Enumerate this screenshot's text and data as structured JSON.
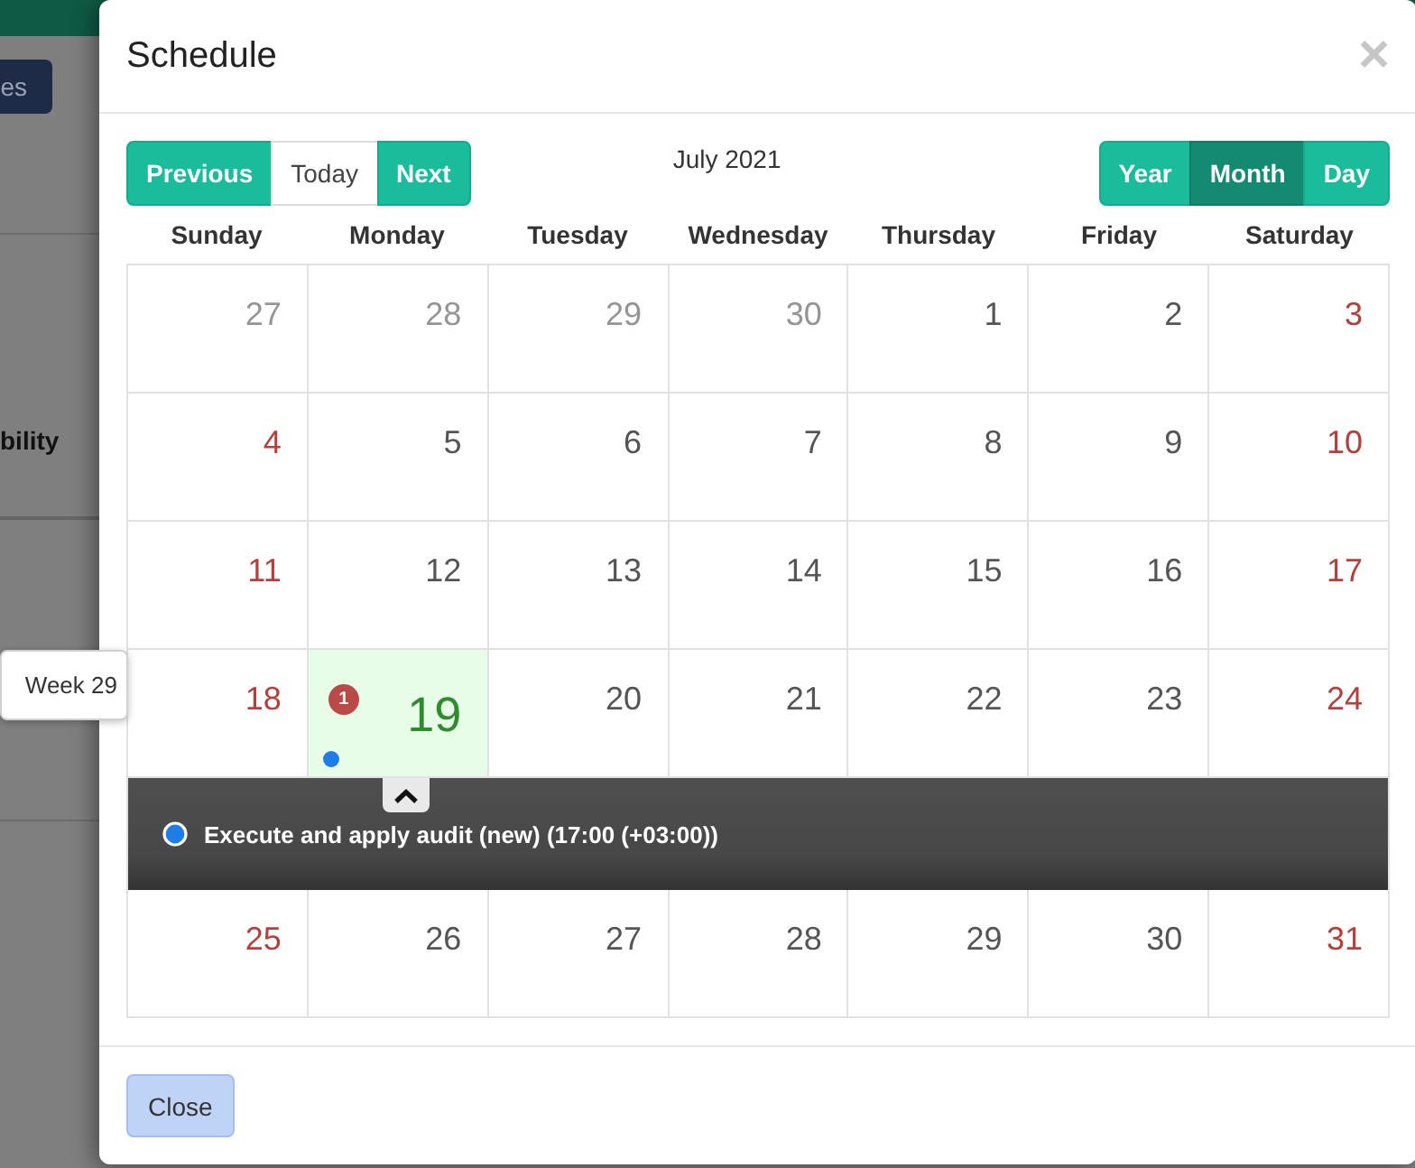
{
  "background": {
    "button": "es",
    "label": "bility"
  },
  "dialog": {
    "title": "Schedule",
    "close_symbol": "×"
  },
  "toolbar": {
    "nav": [
      {
        "label": "Previous",
        "kind": "primary"
      },
      {
        "label": "Today",
        "kind": "default"
      },
      {
        "label": "Next",
        "kind": "primary"
      }
    ],
    "period": "July 2021",
    "views": [
      {
        "label": "Year",
        "selected": false
      },
      {
        "label": "Month",
        "selected": true
      },
      {
        "label": "Day",
        "selected": false
      }
    ]
  },
  "weekdays": [
    {
      "label": "Sunday",
      "weekend": true
    },
    {
      "label": "Monday",
      "weekend": false
    },
    {
      "label": "Tuesday",
      "weekend": false
    },
    {
      "label": "Wednesday",
      "weekend": false
    },
    {
      "label": "Thursday",
      "weekend": false
    },
    {
      "label": "Friday",
      "weekend": false
    },
    {
      "label": "Saturday",
      "weekend": true
    }
  ],
  "weeks": [
    {
      "days": [
        {
          "label": "27",
          "outside": true,
          "today": false,
          "expanded": false
        },
        {
          "label": "28",
          "outside": true,
          "today": false,
          "expanded": false
        },
        {
          "label": "29",
          "outside": true,
          "today": false,
          "expanded": false
        },
        {
          "label": "30",
          "outside": true,
          "today": false,
          "expanded": false
        },
        {
          "label": "1",
          "outside": false,
          "today": false,
          "expanded": false
        },
        {
          "label": "2",
          "outside": false,
          "today": false,
          "expanded": false
        },
        {
          "label": "3",
          "outside": false,
          "today": false,
          "expanded": false
        }
      ]
    },
    {
      "days": [
        {
          "label": "4",
          "outside": false,
          "today": false,
          "expanded": false
        },
        {
          "label": "5",
          "outside": false,
          "today": false,
          "expanded": false
        },
        {
          "label": "6",
          "outside": false,
          "today": false,
          "expanded": false
        },
        {
          "label": "7",
          "outside": false,
          "today": false,
          "expanded": false
        },
        {
          "label": "8",
          "outside": false,
          "today": false,
          "expanded": false
        },
        {
          "label": "9",
          "outside": false,
          "today": false,
          "expanded": false
        },
        {
          "label": "10",
          "outside": false,
          "today": false,
          "expanded": false
        }
      ]
    },
    {
      "days": [
        {
          "label": "11",
          "outside": false,
          "today": false,
          "expanded": false
        },
        {
          "label": "12",
          "outside": false,
          "today": false,
          "expanded": false
        },
        {
          "label": "13",
          "outside": false,
          "today": false,
          "expanded": false
        },
        {
          "label": "14",
          "outside": false,
          "today": false,
          "expanded": false
        },
        {
          "label": "15",
          "outside": false,
          "today": false,
          "expanded": false
        },
        {
          "label": "16",
          "outside": false,
          "today": false,
          "expanded": false
        },
        {
          "label": "17",
          "outside": false,
          "today": false,
          "expanded": false
        }
      ]
    },
    {
      "tooltip": "Week 29",
      "days": [
        {
          "label": "18",
          "outside": false,
          "today": false,
          "expanded": false
        },
        {
          "label": "19",
          "outside": false,
          "today": true,
          "expanded": true,
          "badge": "1",
          "events": [
            {
              "title": "Execute and apply audit (new) (17:00 (+03:00))",
              "color": "#1e7ee6"
            }
          ]
        },
        {
          "label": "20",
          "outside": false,
          "today": false,
          "expanded": false
        },
        {
          "label": "21",
          "outside": false,
          "today": false,
          "expanded": false
        },
        {
          "label": "22",
          "outside": false,
          "today": false,
          "expanded": false
        },
        {
          "label": "23",
          "outside": false,
          "today": false,
          "expanded": false
        },
        {
          "label": "24",
          "outside": false,
          "today": false,
          "expanded": false
        }
      ]
    },
    {
      "days": [
        {
          "label": "25",
          "outside": false,
          "today": false,
          "expanded": false
        },
        {
          "label": "26",
          "outside": false,
          "today": false,
          "expanded": false
        },
        {
          "label": "27",
          "outside": false,
          "today": false,
          "expanded": false
        },
        {
          "label": "28",
          "outside": false,
          "today": false,
          "expanded": false
        },
        {
          "label": "29",
          "outside": false,
          "today": false,
          "expanded": false
        },
        {
          "label": "30",
          "outside": false,
          "today": false,
          "expanded": false
        },
        {
          "label": "31",
          "outside": false,
          "today": false,
          "expanded": false
        }
      ]
    }
  ],
  "footer": {
    "buttons": [
      "Close"
    ]
  }
}
